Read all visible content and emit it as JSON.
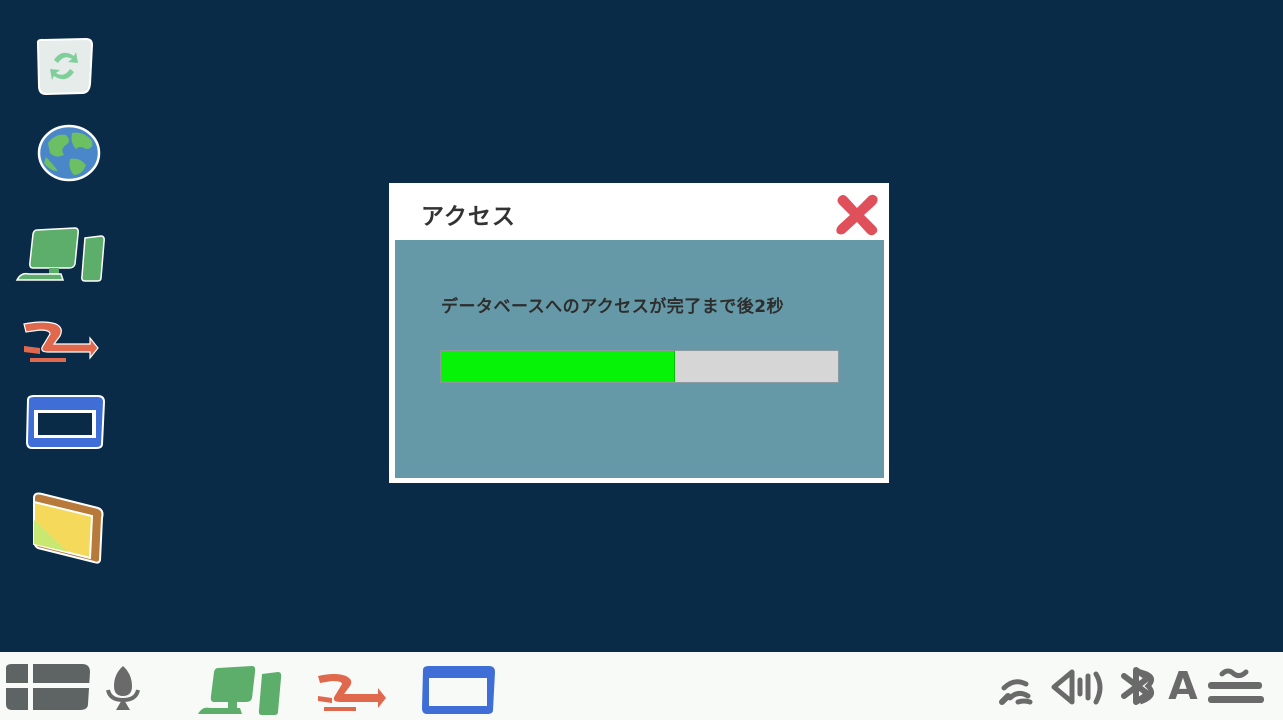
{
  "desktop": {
    "icons": [
      {
        "name": "recycle-bin-icon"
      },
      {
        "name": "globe-icon"
      },
      {
        "name": "computer-icon"
      },
      {
        "name": "network-icon"
      },
      {
        "name": "window-icon"
      },
      {
        "name": "folder-icon"
      }
    ]
  },
  "dialog": {
    "title": "アクセス",
    "message": "データベースへのアクセスが完了まで後2秒",
    "progress_fraction": 0.59,
    "colors": {
      "body": "#6699a7",
      "progress_fill": "#06f206",
      "progress_track": "#d6d6d6",
      "close": "#e0505a"
    }
  },
  "taskbar": {
    "language_indicator": "A",
    "items": [
      "start-icon",
      "microphone-icon",
      "computer-icon",
      "network-icon",
      "window-icon"
    ],
    "tray": [
      "wifi-icon",
      "volume-icon",
      "bluetooth-icon",
      "menu-icon"
    ]
  },
  "colors": {
    "desktop_background": "#0a2b47",
    "taskbar_background": "#f8faf8"
  }
}
